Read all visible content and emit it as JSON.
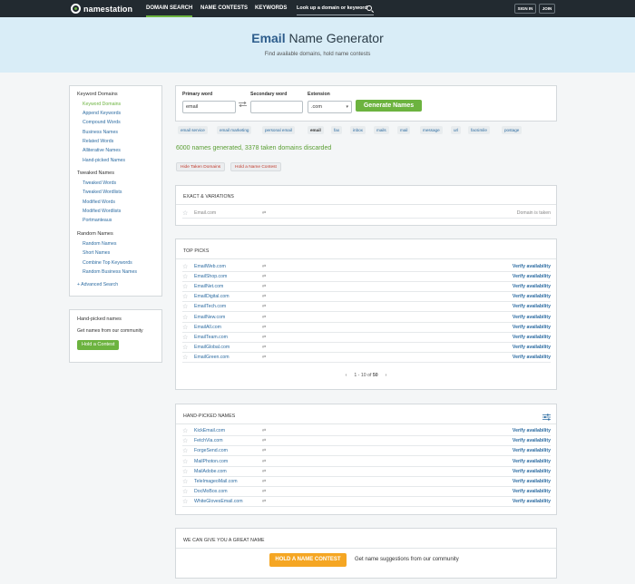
{
  "header": {
    "brand": "namestation",
    "nav": [
      "DOMAIN SEARCH",
      "NAME CONTESTS",
      "KEYWORDS"
    ],
    "lookup_label": "Look up a domain or keyword",
    "sign_in": "SIGN IN",
    "join": "JOIN"
  },
  "hero": {
    "title_bold": "Email",
    "title_rest": " Name Generator",
    "subtitle": "Find available domains, hold name contests"
  },
  "sidebar": {
    "keyword_domains": {
      "heading": "Keyword Domains",
      "items": [
        "Keyword Domains",
        "Append Keywords",
        "Compound Words",
        "Business Names",
        "Related Words",
        "Alliterative Names",
        "Hand-picked Names"
      ]
    },
    "tweaked_names": {
      "heading": "Tweaked Names",
      "items": [
        "Tweaked Words",
        "Tweaked Wordlists",
        "Modified Words",
        "Modified Wordlists",
        "Portmanteaus"
      ]
    },
    "random_names": {
      "heading": "Random Names",
      "items": [
        "Random Names",
        "Short Names",
        "Combine Top Keywords",
        "Random Business Names"
      ]
    },
    "advanced_search": "+ Advanced Search",
    "handpicked_box": {
      "heading": "Hand-picked names",
      "text": "Get names from our community",
      "button": "Hold a Contest"
    }
  },
  "form": {
    "primary_label": "Primary word",
    "primary_value": "email",
    "secondary_label": "Secondary word",
    "secondary_value": "",
    "extension_label": "Extension",
    "extension_value": ".com",
    "generate_label": "Generate Names"
  },
  "chips": [
    "email service",
    "email marketing",
    "personal email",
    "email",
    "fax",
    "inbox",
    "mails",
    "mail",
    "message",
    "url",
    "facsimile",
    "postage"
  ],
  "status": "6000 names generated, 3378 taken domains discarded",
  "actions": {
    "hide_taken": "Hide Taken Domains",
    "hold_contest": "Hold a Name Contest"
  },
  "exact": {
    "title": "EXACT & VARIATIONS",
    "rows": [
      {
        "name": "Email.com",
        "action": "Domain is taken"
      }
    ]
  },
  "top_picks": {
    "title": "TOP PICKS",
    "rows": [
      {
        "name": "EmailWeb.com",
        "action": "Verify availability"
      },
      {
        "name": "EmailShop.com",
        "action": "Verify availability"
      },
      {
        "name": "EmailNet.com",
        "action": "Verify availability"
      },
      {
        "name": "EmailDigital.com",
        "action": "Verify availability"
      },
      {
        "name": "EmailTech.com",
        "action": "Verify availability"
      },
      {
        "name": "EmailNew.com",
        "action": "Verify availability"
      },
      {
        "name": "EmailAll.com",
        "action": "Verify availability"
      },
      {
        "name": "EmailTeam.com",
        "action": "Verify availability"
      },
      {
        "name": "EmailGlobal.com",
        "action": "Verify availability"
      },
      {
        "name": "EmailGreen.com",
        "action": "Verify availability"
      }
    ],
    "pager_prefix": "1 - 10 of ",
    "pager_total": "50"
  },
  "handpicked": {
    "title": "HAND-PICKED NAMES",
    "rows": [
      {
        "name": "KickEmail.com",
        "action": "Verify availability"
      },
      {
        "name": "FetchVia.com",
        "action": "Verify availability"
      },
      {
        "name": "ForgeSend.com",
        "action": "Verify availability"
      },
      {
        "name": "MailPhoton.com",
        "action": "Verify availability"
      },
      {
        "name": "MailAdobe.com",
        "action": "Verify availability"
      },
      {
        "name": "TeleImageoMail.com",
        "action": "Verify availability"
      },
      {
        "name": "DocMoBox.com",
        "action": "Verify availability"
      },
      {
        "name": "WhiteGlovesEmail.com",
        "action": "Verify availability"
      }
    ]
  },
  "cta": {
    "title": "WE CAN GIVE YOU A GREAT NAME",
    "button": "HOLD A NAME CONTEST",
    "text": "Get name suggestions from our community"
  },
  "icons": {
    "star": "star-outline-icon",
    "swap": "swap-arrows-icon",
    "search": "search-icon",
    "filter": "sliders-icon"
  },
  "colors": {
    "nav_bg": "#222a30",
    "hero_bg": "#d9edf7",
    "accent_green": "#6cb33f",
    "link_blue": "#2d6ca2",
    "cta_orange": "#f5a623"
  }
}
